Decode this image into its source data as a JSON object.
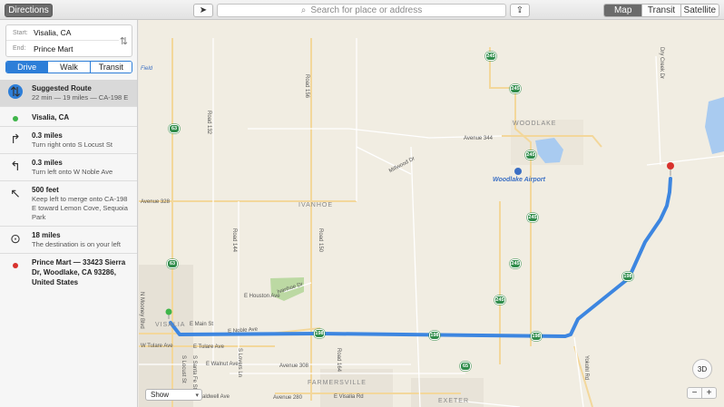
{
  "toolbar": {
    "directions_label": "Directions",
    "search_placeholder": "Search for place or address",
    "map_types": [
      "Map",
      "Transit",
      "Satellite"
    ],
    "active_map_type": "Map"
  },
  "sidebar": {
    "start_label": "Start:",
    "start_value": "Visalia, CA",
    "end_label": "End:",
    "end_value": "Prince Mart",
    "modes": [
      "Drive",
      "Walk",
      "Transit"
    ],
    "active_mode": "Drive",
    "steps": [
      {
        "icon": "route-icon",
        "title": "Suggested Route",
        "detail": "22 min — 19 miles — CA-198 E"
      },
      {
        "icon": "start-pin-icon",
        "title": "Visalia, CA",
        "detail": ""
      },
      {
        "icon": "turn-right-icon",
        "title": "0.3 miles",
        "detail": "Turn right onto S Locust St"
      },
      {
        "icon": "turn-left-icon",
        "title": "0.3 miles",
        "detail": "Turn left onto W Noble Ave"
      },
      {
        "icon": "keep-left-icon",
        "title": "500 feet",
        "detail": "Keep left to merge onto CA-198 E toward Lemon Cove, Sequoia Park"
      },
      {
        "icon": "destination-icon",
        "title": "18 miles",
        "detail": "The destination is on your left"
      },
      {
        "icon": "end-pin-icon",
        "title": "Prince Mart — 33423 Sierra Dr, Woodlake, CA  93286, United States",
        "detail": ""
      }
    ]
  },
  "map": {
    "towns": [
      "WOODLAKE",
      "IVANHOE",
      "VISALIA",
      "FARMERSVILLE",
      "EXETER"
    ],
    "airport": "Woodlake Airport",
    "field_label": "Field",
    "roads": [
      "Avenue 344",
      "Avenue 328",
      "Avenue 308",
      "Avenue 280",
      "Millwood Dr",
      "E Houston Ave",
      "Ivanhoe Dr",
      "E Main St",
      "W Tulare Ave",
      "E Tulare Ave",
      "E Walnut Ave",
      "E Caldwell Ave",
      "E Visalia Rd",
      "E Noble Ave",
      "Road 132",
      "Road 156",
      "Road 144",
      "Road 150",
      "Road 164",
      "Dry Creek Dr",
      "Yokohl Rd",
      "N Mooney Blvd",
      "S Locust St",
      "S Lovers Ln",
      "S Santa Fe St"
    ],
    "shields": [
      "245",
      "245",
      "245",
      "245",
      "245",
      "63",
      "63",
      "198",
      "198",
      "198",
      "198",
      "198",
      "65"
    ],
    "route_color": "#3d86e0",
    "show_label": "Show",
    "btn_3d": "3D",
    "zoom_out": "−",
    "zoom_in": "+"
  }
}
